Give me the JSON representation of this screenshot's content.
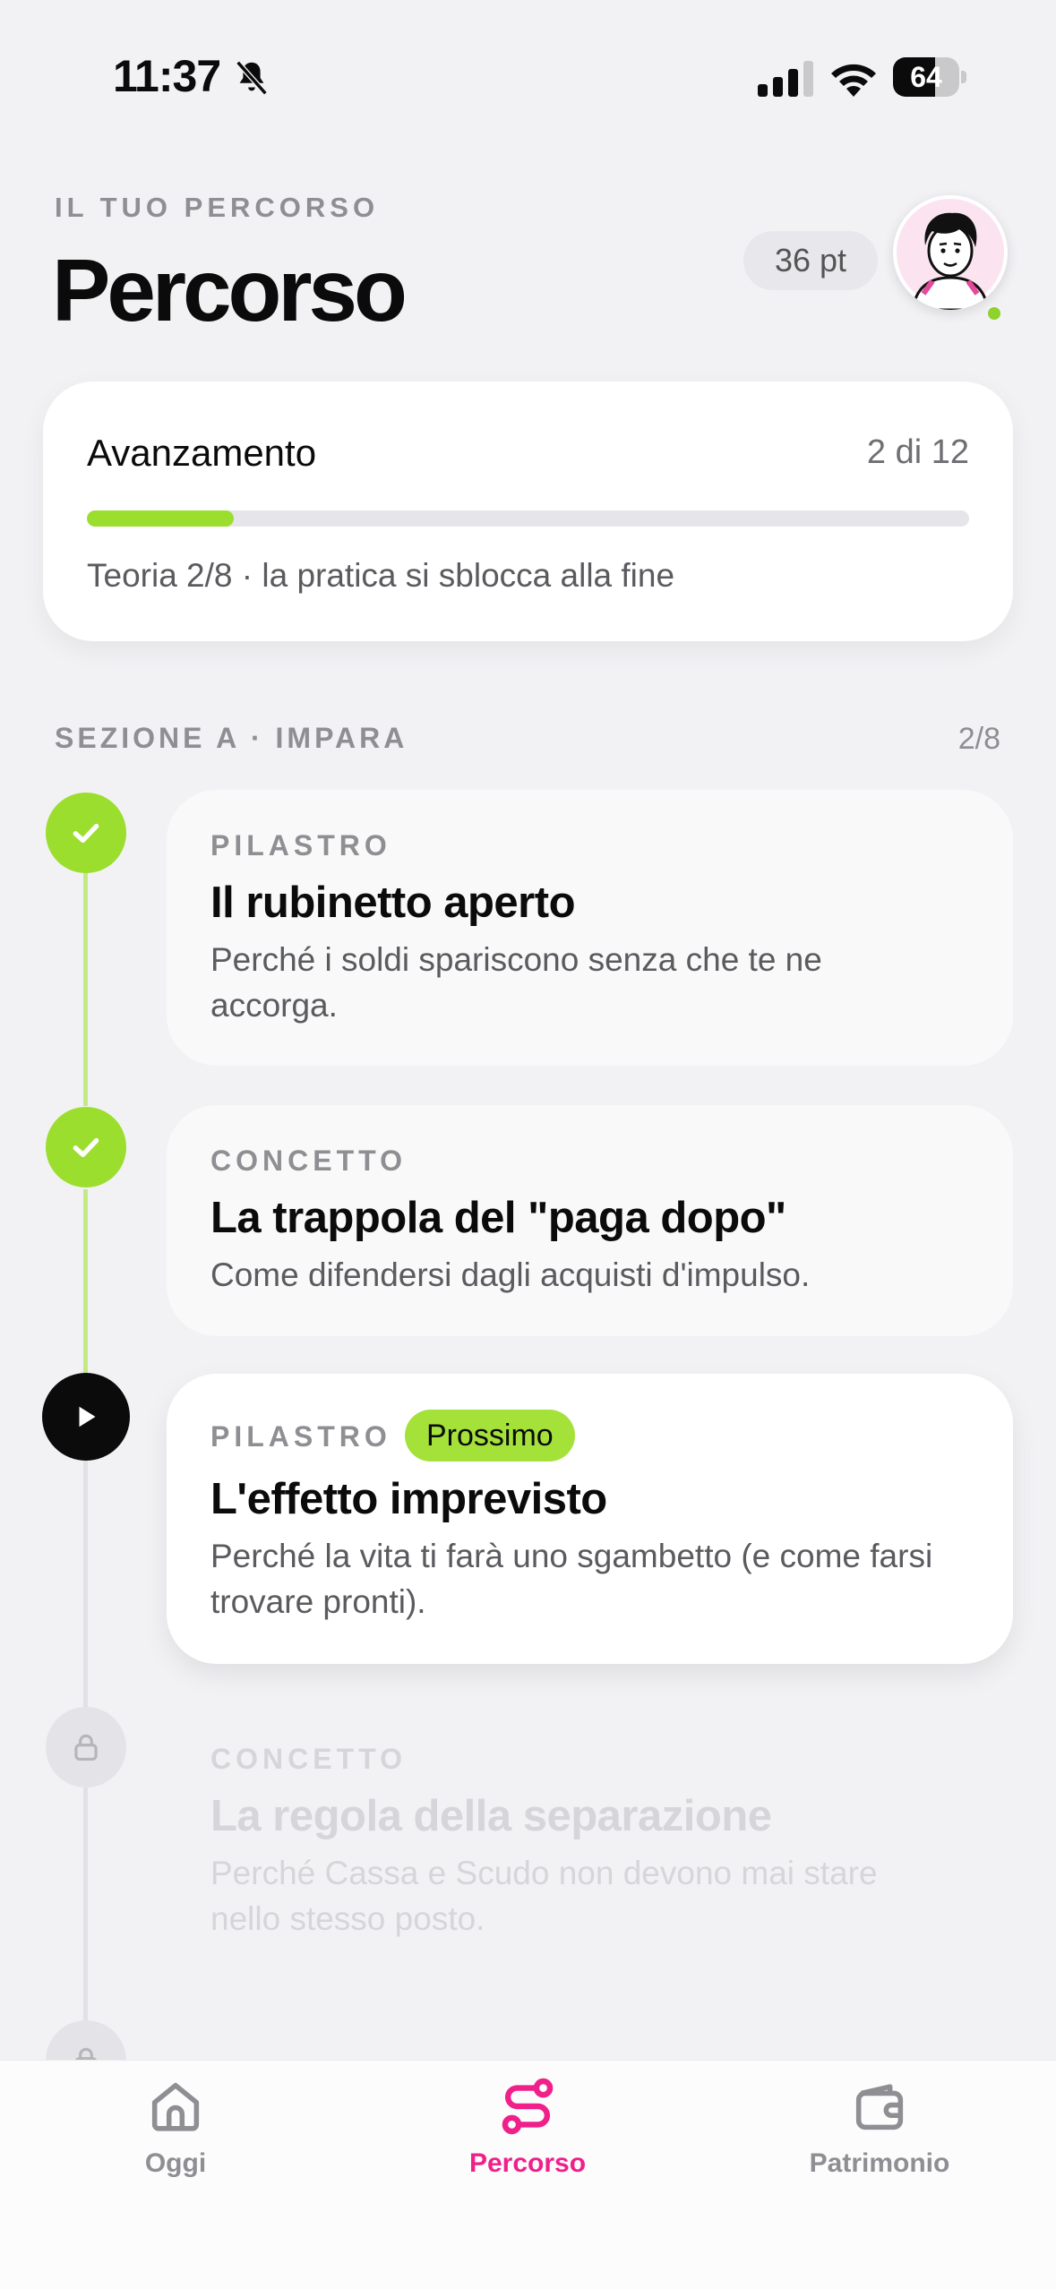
{
  "status_bar": {
    "time": "11:37",
    "battery": "64",
    "battery_level": 0.64
  },
  "header": {
    "eyebrow": "IL TUO PERCORSO",
    "title": "Percorso",
    "points": "36 pt"
  },
  "progress": {
    "label": "Avanzamento",
    "count": "2 di 12",
    "value": 0.1667,
    "note": "Teoria 2/8 · la pratica si sblocca alla fine"
  },
  "section": {
    "title": "SEZIONE A · IMPARA",
    "count": "2/8"
  },
  "lessons": [
    {
      "kind": "PILASTRO",
      "title": "Il rubinetto aperto",
      "desc": "Perché i soldi spariscono senza che te ne accorga.",
      "state": "done"
    },
    {
      "kind": "CONCETTO",
      "title": "La trappola del \"paga dopo\"",
      "desc": "Come difendersi dagli acquisti d'impulso.",
      "state": "done"
    },
    {
      "kind": "PILASTRO",
      "title": "L'effetto imprevisto",
      "desc": "Perché la vita ti farà uno sgambetto (e come farsi trovare pronti).",
      "state": "current",
      "badge": "Prossimo"
    },
    {
      "kind": "CONCETTO",
      "title": "La regola della separazione",
      "desc": "Perché Cassa e Scudo non devono mai stare nello stesso posto.",
      "state": "locked"
    }
  ],
  "tabs": [
    {
      "label": "Oggi",
      "icon": "home-icon"
    },
    {
      "label": "Percorso",
      "icon": "route-icon",
      "active": true
    },
    {
      "label": "Patrimonio",
      "icon": "wallet-icon"
    }
  ],
  "colors": {
    "accent_green": "#9bde2e",
    "accent_pink": "#f0208a",
    "background": "#f2f2f5"
  }
}
